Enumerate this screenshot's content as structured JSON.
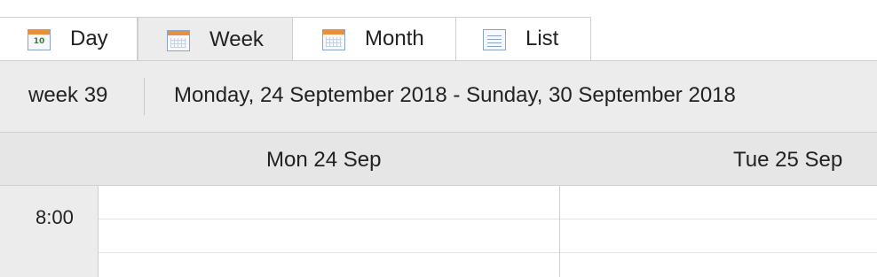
{
  "tabs": [
    {
      "label": "Day",
      "icon": "calendar-day-icon",
      "day_number": "10"
    },
    {
      "label": "Week",
      "icon": "calendar-week-icon",
      "active": true
    },
    {
      "label": "Month",
      "icon": "calendar-month-icon"
    },
    {
      "label": "List",
      "icon": "calendar-list-icon"
    }
  ],
  "header": {
    "week_label": "week 39",
    "date_range": "Monday, 24 September 2018 - Sunday, 30 September 2018"
  },
  "days": [
    {
      "label": "Mon 24 Sep"
    },
    {
      "label": "Tue 25 Sep"
    }
  ],
  "times": [
    "8:00"
  ],
  "colors": {
    "header_bg": "#ececec",
    "border": "#cfcfcf",
    "icon_green": "#4e9b4a",
    "icon_orange": "#e98f3c",
    "icon_blue": "#8aa4c8"
  }
}
